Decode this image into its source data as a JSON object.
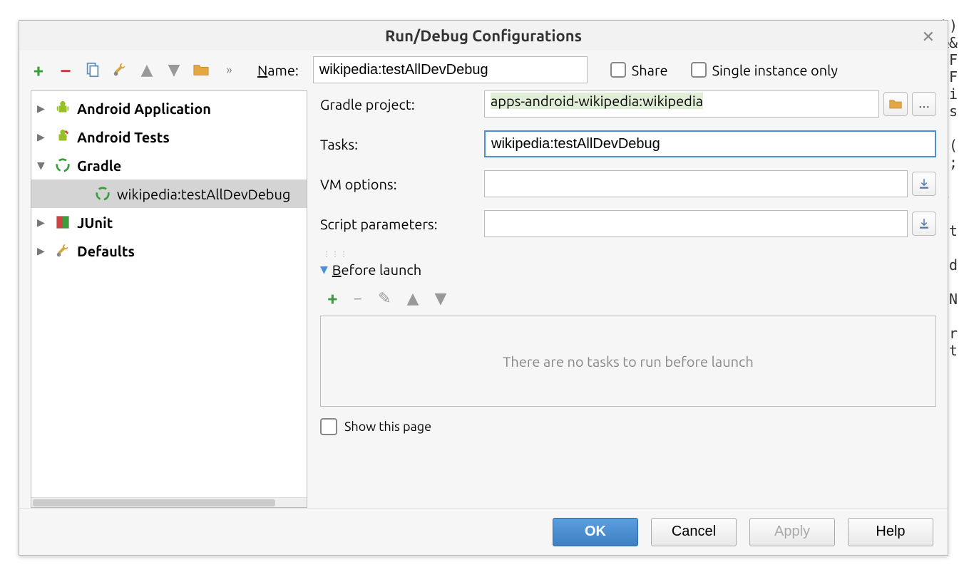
{
  "dialog": {
    "title": "Run/Debug Configurations"
  },
  "toolbar": {
    "name_label_html": "Name:",
    "name_value": "wikipedia:testAllDevDebug",
    "share_label": "Share",
    "single_instance_label": "Single instance only"
  },
  "tree": {
    "items": [
      {
        "label": "Android Application"
      },
      {
        "label": "Android Tests"
      },
      {
        "label": "Gradle"
      },
      {
        "label": "wikipedia:testAllDevDebug"
      },
      {
        "label": "JUnit"
      },
      {
        "label": "Defaults"
      }
    ]
  },
  "form": {
    "gradle_project_label": "Gradle project:",
    "gradle_project_value": "apps-android-wikipedia:wikipedia",
    "tasks_label": "Tasks:",
    "tasks_value": "wikipedia:testAllDevDebug",
    "vm_options_label": "VM options:",
    "vm_options_value": "",
    "script_params_label": "Script parameters:",
    "script_params_value": ""
  },
  "before_launch": {
    "header": "Before launch",
    "empty_text": "There are no tasks to run before launch"
  },
  "show_page_label": "Show this page",
  "buttons": {
    "ok": "OK",
    "cancel": "Cancel",
    "apply": "Apply",
    "help": "Help"
  }
}
